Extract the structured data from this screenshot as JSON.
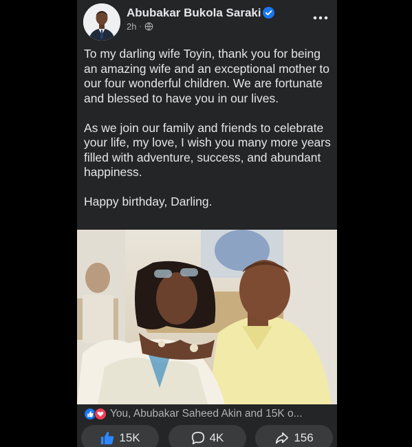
{
  "post": {
    "author": "Abubakar Bukola Saraki",
    "time": "2h",
    "separator": "·",
    "paragraphs": [
      "To my darling wife Toyin, thank you for being an amazing wife and an exceptional mother to our four wonderful children. We are fortunate and blessed to have you in our lives.",
      "As we join our family and friends to celebrate your life, my love, I wish you many more years filled with adventure, success, and abundant happiness.",
      "Happy birthday, Darling."
    ]
  },
  "reactions": {
    "summary": "You, Abubakar Saheed Akin and 15K o...",
    "icons": [
      "like-icon",
      "love-icon"
    ]
  },
  "actions": {
    "like_count": "15K",
    "comment_count": "4K",
    "share_count": "156"
  },
  "colors": {
    "background": "#242526",
    "text": "#e4e6eb",
    "muted": "#b0b3b8",
    "verified": "#1877f2",
    "love": "#f33e58",
    "button": "#3a3b3c"
  }
}
